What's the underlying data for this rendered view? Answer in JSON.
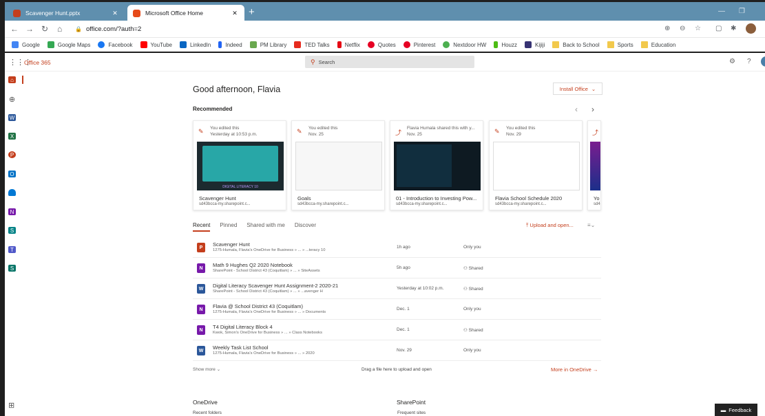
{
  "browser": {
    "tabs": [
      {
        "label": "Scavenger Hunt.pptx"
      },
      {
        "label": "Microsoft Office Home"
      }
    ],
    "url": "office.com/?auth=2",
    "bookmarks": [
      "Google",
      "Google Maps",
      "Facebook",
      "YouTube",
      "LinkedIn",
      "Indeed",
      "PM Library",
      "TED Talks",
      "Netflix",
      "Quotes",
      "Pinterest",
      "Nextdoor HW",
      "Houzz",
      "Kijiji",
      "Back to School",
      "Sports",
      "Education"
    ]
  },
  "appbar": {
    "brand": "Office 365",
    "search_placeholder": "Search"
  },
  "main": {
    "greeting": "Good afternoon, Flavia",
    "install_label": "Install Office",
    "recommended_title": "Recommended",
    "cards": [
      {
        "line1": "You edited this",
        "line2": "Yesterday at 10:53 p.m.",
        "name": "Scavenger Hunt",
        "location": "sd43bcca-my.sharepoint.c...",
        "thumb_caption": "DIGITAL LITERACY 10"
      },
      {
        "line1": "You edited this",
        "line2": "Nov. 25",
        "name": "Goals",
        "location": "sd43bcca-my.sharepoint.c..."
      },
      {
        "line1": "Flavia Humala shared this with y...",
        "line2": "Nov. 25",
        "name": "01 - Introduction to Investing Pow...",
        "location": "sd43bcca-my.sharepoint.c..."
      },
      {
        "line1": "You edited this",
        "line2": "Nov. 29",
        "name": "Flavia School Schedule 2020",
        "location": "sd43bcca-my.sharepoint.c..."
      },
      {
        "line1": "",
        "line2": "",
        "name": "Yo",
        "location": "sd4"
      }
    ],
    "tabs": [
      "Recent",
      "Pinned",
      "Shared with me",
      "Discover"
    ],
    "upload_label": "Upload and open...",
    "files": [
      {
        "name": "Scavenger Hunt",
        "path": "1275-Humala, Flavia's OneDrive for Business » ... » ...teracy 10",
        "time": "1h ago",
        "share": "Only you",
        "type": "P",
        "color": "#c43e1c"
      },
      {
        "name": "Math 9 Hughes Q2 2020 Notebook",
        "path": "SharePoint - School District 43 (Coquitlam) » ... » SiteAssets",
        "time": "5h ago",
        "share": "Shared",
        "type": "N",
        "color": "#7719aa"
      },
      {
        "name": "Digital Literacy Scavenger Hunt Assignment-2 2020-21",
        "path": "SharePoint - School District 43 (Coquitlam) » ... » ...avenger H",
        "time": "Yesterday at 10:02 p.m.",
        "share": "Shared",
        "type": "W",
        "color": "#2b579a"
      },
      {
        "name": "Flavia @ School District 43 (Coquitlam)",
        "path": "1275-Humala, Flavia's OneDrive for Business » ... » Documents",
        "time": "Dec. 1",
        "share": "Only you",
        "type": "N",
        "color": "#7719aa"
      },
      {
        "name": "T4 Digital Literacy Block 4",
        "path": "Kwok, Simon's OneDrive for Business » ... » Class Notebooks",
        "time": "Dec. 1",
        "share": "Shared",
        "type": "N",
        "color": "#7719aa"
      },
      {
        "name": "Weekly Task List School",
        "path": "1275-Humala, Flavia's OneDrive for Business » ... » 2020",
        "time": "Nov. 29",
        "share": "Only you",
        "type": "W",
        "color": "#2b579a"
      }
    ],
    "show_more": "Show more",
    "drag_text": "Drag a file here to upload and open",
    "more_onedrive": "More in OneDrive",
    "onedrive_title": "OneDrive",
    "onedrive_sub": "Recent folders",
    "sharepoint_title": "SharePoint",
    "sharepoint_sub": "Frequent sites",
    "feedback": "Feedback"
  }
}
